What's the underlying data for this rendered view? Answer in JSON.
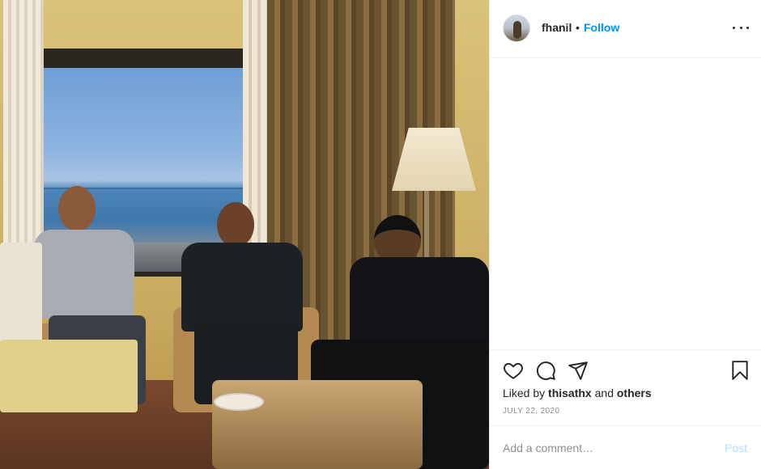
{
  "post": {
    "username": "fhanil",
    "separator": "•",
    "follow_label": "Follow",
    "avatar_icon": "profile-photo",
    "more_icon": "ellipsis-icon"
  },
  "actions": {
    "like_icon": "heart-icon",
    "comment_icon": "comment-bubble-icon",
    "share_icon": "paper-plane-icon",
    "save_icon": "bookmark-icon"
  },
  "likes": {
    "prefix": "Liked by",
    "user": "thisathx",
    "conjunction": "and",
    "others": "others"
  },
  "date": "JULY 22, 2020",
  "comment_box": {
    "placeholder": "Add a comment…",
    "post_label": "Post"
  },
  "colors": {
    "accent": "#0095f6",
    "post_disabled": "#b2dffc",
    "muted": "#8e8e8e",
    "text": "#262626"
  }
}
